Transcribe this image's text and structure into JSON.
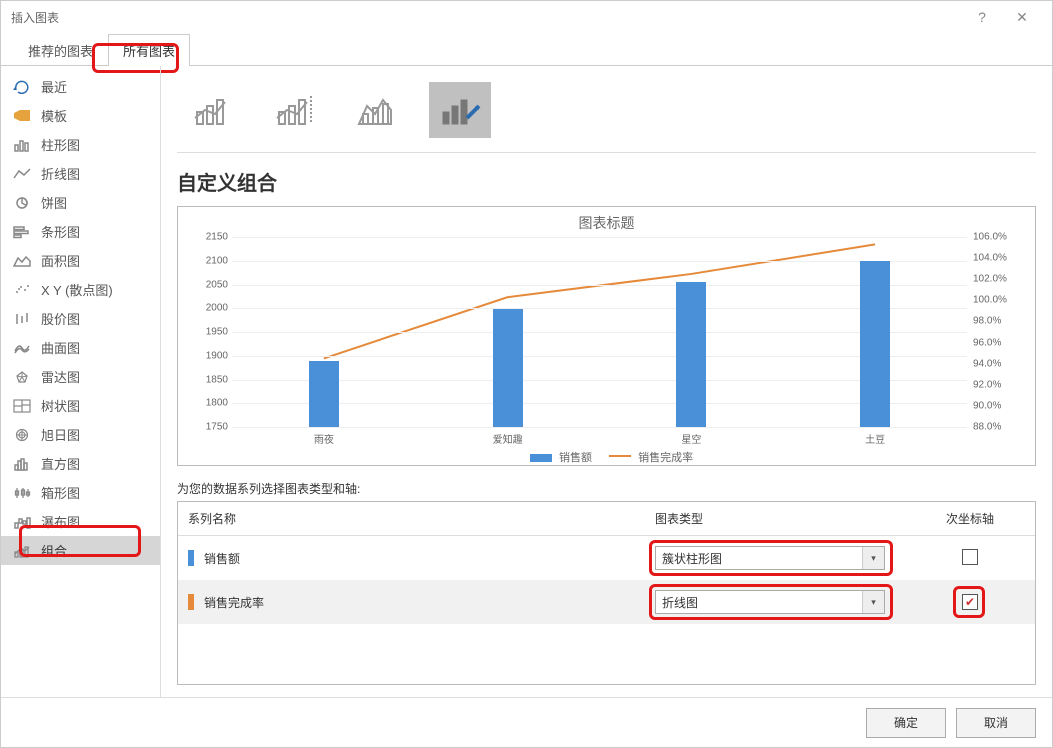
{
  "title": "插入图表",
  "tabs": {
    "recommended": "推荐的图表",
    "all": "所有图表"
  },
  "sidebar": {
    "items": [
      {
        "label": "最近",
        "icon": "recent"
      },
      {
        "label": "模板",
        "icon": "template"
      },
      {
        "label": "柱形图",
        "icon": "column"
      },
      {
        "label": "折线图",
        "icon": "line"
      },
      {
        "label": "饼图",
        "icon": "pie"
      },
      {
        "label": "条形图",
        "icon": "bar"
      },
      {
        "label": "面积图",
        "icon": "area"
      },
      {
        "label": "X Y (散点图)",
        "icon": "scatter"
      },
      {
        "label": "股价图",
        "icon": "stock"
      },
      {
        "label": "曲面图",
        "icon": "surface"
      },
      {
        "label": "雷达图",
        "icon": "radar"
      },
      {
        "label": "树状图",
        "icon": "treemap"
      },
      {
        "label": "旭日图",
        "icon": "sunburst"
      },
      {
        "label": "直方图",
        "icon": "histogram"
      },
      {
        "label": "箱形图",
        "icon": "boxplot"
      },
      {
        "label": "瀑布图",
        "icon": "waterfall"
      },
      {
        "label": "组合",
        "icon": "combo"
      }
    ]
  },
  "section_title": "自定义组合",
  "config_prompt": "为您的数据系列选择图表类型和轴:",
  "config_headers": {
    "name": "系列名称",
    "type": "图表类型",
    "axis": "次坐标轴"
  },
  "series_rows": [
    {
      "name": "销售额",
      "type": "簇状柱形图",
      "secondary": false,
      "swatch": "#4a90d9"
    },
    {
      "name": "销售完成率",
      "type": "折线图",
      "secondary": true,
      "swatch": "#e58a3a"
    }
  ],
  "footer": {
    "ok": "确定",
    "cancel": "取消"
  },
  "chart_data": {
    "type": "combo",
    "title": "图表标题",
    "categories": [
      "雨夜",
      "爱知趣",
      "星空",
      "土豆"
    ],
    "series": [
      {
        "name": "销售额",
        "type": "bar",
        "axis": "left",
        "color": "#4a90d9",
        "values": [
          1890,
          1998,
          2055,
          2100
        ]
      },
      {
        "name": "销售完成率",
        "type": "line",
        "axis": "right",
        "color": "#e58a3a",
        "values": [
          94.5,
          100.3,
          102.5,
          105.3
        ]
      }
    ],
    "y_left": {
      "min": 1750,
      "max": 2150,
      "ticks": [
        1750,
        1800,
        1850,
        1900,
        1950,
        2000,
        2050,
        2100,
        2150
      ]
    },
    "y_right": {
      "min": 88.0,
      "max": 106.0,
      "ticks": [
        88.0,
        90.0,
        92.0,
        94.0,
        96.0,
        98.0,
        100.0,
        102.0,
        104.0,
        106.0
      ],
      "suffix": "%"
    },
    "legend": [
      "销售额",
      "销售完成率"
    ]
  }
}
